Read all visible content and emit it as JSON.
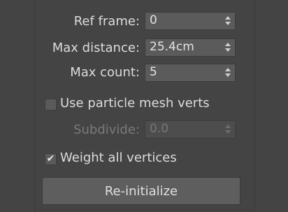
{
  "rollout": {
    "ref_frame": {
      "label": "Ref frame:",
      "value": "0"
    },
    "max_distance": {
      "label": "Max distance:",
      "value": "25.4cm"
    },
    "max_count": {
      "label": "Max count:",
      "value": "5"
    },
    "use_particle_mesh_verts": {
      "label": "Use particle mesh verts",
      "checked": false
    },
    "subdivide": {
      "label": "Subdivide:",
      "value": "0.0",
      "disabled": true
    },
    "weight_all_vertices": {
      "label": "Weight all vertices",
      "checked": true,
      "check_glyph": "✔"
    },
    "reinitialize_button": {
      "label": "Re-initialize"
    }
  }
}
